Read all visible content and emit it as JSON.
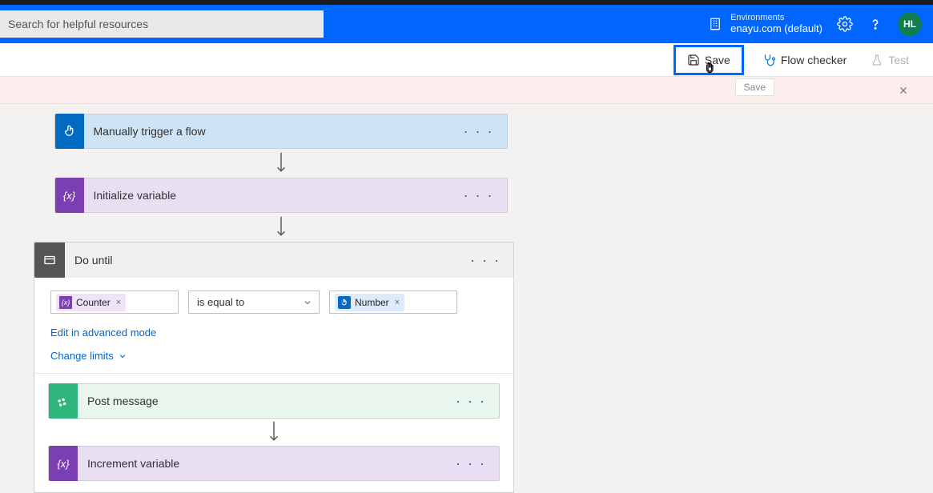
{
  "search": {
    "placeholder": "Search for helpful resources"
  },
  "env": {
    "label": "Environments",
    "name": "enayu.com (default)"
  },
  "avatar": {
    "initials": "HL"
  },
  "actions": {
    "save": "Save",
    "checker": "Flow checker",
    "test": "Test",
    "tooltip": "Save"
  },
  "flow": {
    "trigger": "Manually trigger a flow",
    "init_var": "Initialize variable",
    "do_until": {
      "title": "Do until",
      "left_token": "Counter",
      "operator": "is equal to",
      "right_token": "Number",
      "advanced": "Edit in advanced mode",
      "limits": "Change limits"
    },
    "post_msg": "Post message",
    "inc_var": "Increment variable"
  }
}
